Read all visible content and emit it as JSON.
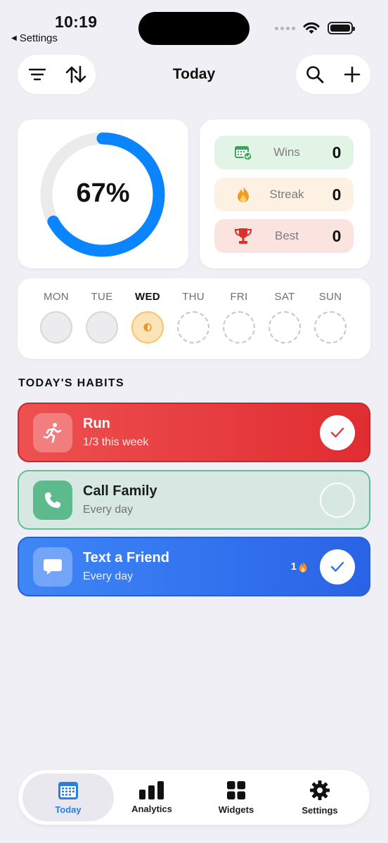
{
  "status_bar": {
    "time": "10:19",
    "back_label": "Settings"
  },
  "header": {
    "title": "Today"
  },
  "progress": {
    "percent_label": "67%",
    "fraction": 0.67
  },
  "stats": [
    {
      "label": "Wins",
      "value": "0",
      "icon": "calendar-check-icon",
      "bg": "#e1f4e6"
    },
    {
      "label": "Streak",
      "value": "0",
      "icon": "flame-icon",
      "bg": "#fdf1e3"
    },
    {
      "label": "Best",
      "value": "0",
      "icon": "trophy-icon",
      "bg": "#fbe4e0"
    }
  ],
  "week": {
    "days": [
      "MON",
      "TUE",
      "WED",
      "THU",
      "FRI",
      "SAT",
      "SUN"
    ],
    "today_index": 2
  },
  "section_title": "TODAY'S HABITS",
  "habits": [
    {
      "name": "Run",
      "subtitle": "1/3 this week",
      "icon": "runner-icon",
      "completed": true,
      "color": "#e53935"
    },
    {
      "name": "Call Family",
      "subtitle": "Every day",
      "icon": "phone-icon",
      "completed": false,
      "color": "#5cba8d"
    },
    {
      "name": "Text a Friend",
      "subtitle": "Every day",
      "icon": "chat-bubble-icon",
      "completed": true,
      "streak": "1",
      "color": "#3478f6"
    }
  ],
  "tabs": [
    {
      "label": "Today",
      "icon": "calendar-icon",
      "selected": true
    },
    {
      "label": "Analytics",
      "icon": "bar-chart-icon",
      "selected": false
    },
    {
      "label": "Widgets",
      "icon": "grid-icon",
      "selected": false
    },
    {
      "label": "Settings",
      "icon": "gear-icon",
      "selected": false
    }
  ],
  "colors": {
    "accent": "#0a84ff",
    "background": "#f0eff5"
  }
}
